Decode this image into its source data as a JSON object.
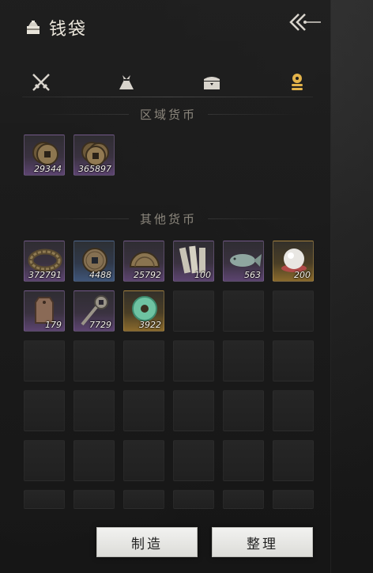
{
  "header": {
    "title": "钱袋",
    "icon": "money-bag-icon"
  },
  "tabs": [
    {
      "icon": "crossed-swords-icon",
      "active": false
    },
    {
      "icon": "cloth-bundle-icon",
      "active": false
    },
    {
      "icon": "chest-icon",
      "active": false
    },
    {
      "icon": "coin-stack-icon",
      "active": true
    }
  ],
  "colors": {
    "active_tab": "#e3b34a",
    "inactive_tab": "#d8d4cc",
    "purple_rarity": "#5c4470",
    "blue_rarity": "#3f5578",
    "gold_rarity": "#8a6a2c"
  },
  "regional": {
    "title": "区域货币",
    "items": [
      {
        "qty": "29344",
        "rarity": "purple",
        "icon": "copper-coin-stack-icon"
      },
      {
        "qty": "365897",
        "rarity": "purple",
        "icon": "copper-coin-stack-icon"
      }
    ]
  },
  "other": {
    "title": "其他货币",
    "items": [
      {
        "qty": "372791",
        "rarity": "purple",
        "icon": "coin-string-icon"
      },
      {
        "qty": "4488",
        "rarity": "blue",
        "icon": "square-hole-coin-icon"
      },
      {
        "qty": "25792",
        "rarity": "purple",
        "icon": "half-coin-icon"
      },
      {
        "qty": "100",
        "rarity": "purple",
        "icon": "bamboo-slips-icon"
      },
      {
        "qty": "563",
        "rarity": "purple",
        "icon": "jade-fish-icon"
      },
      {
        "qty": "200",
        "rarity": "gold",
        "icon": "pearl-icon"
      },
      {
        "qty": "179",
        "rarity": "purple",
        "icon": "bronze-token-icon"
      },
      {
        "qty": "7729",
        "rarity": "purple",
        "icon": "key-coin-icon"
      },
      {
        "qty": "3922",
        "rarity": "gold",
        "icon": "jade-bi-disc-icon"
      }
    ]
  },
  "buttons": {
    "craft": "制造",
    "sort": "整理"
  }
}
